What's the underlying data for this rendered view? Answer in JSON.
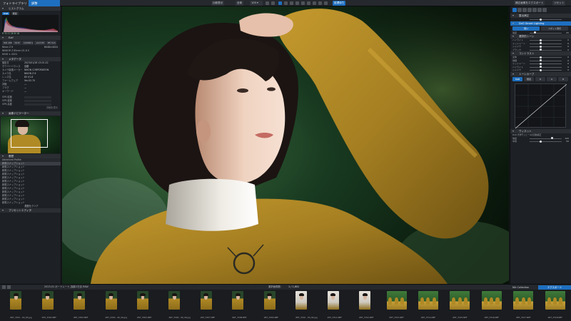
{
  "colors": {
    "accent": "#1e6fbf",
    "panel": "#1d2024",
    "sweater": "#b08a25"
  },
  "topbar": {
    "tab_library": "フォトライブラリ",
    "tab_adjust": "調整",
    "btn_before_after": "比較表示",
    "btn_fit": "全体",
    "zoom": "100",
    "btn_process": "処理待ち",
    "btn_export": "補正画像をエクスポート",
    "btn_reset": "リセット"
  },
  "left": {
    "histogram_title": "ヒストグラム",
    "hist_tabs": [
      "RGB",
      "輝度"
    ],
    "hist_values": "R 31  G 26  B 18",
    "exif_title": "Exif",
    "exif_buttons": [
      "ISO 100",
      "f/2.8",
      "1/2000 s",
      "+0.0 EV",
      "85 mm"
    ],
    "exif_rows": [
      {
        "label": "Nikon Z 6",
        "value": "6048×4024"
      },
      {
        "label": "NIKKOR Z 85mm f/1.8 S",
        "value": ""
      },
      {
        "label": "6048 × 4024",
        "value": ""
      }
    ],
    "meta_title": "メタデータ",
    "meta_rows": [
      {
        "label": "撮影日",
        "value": "2023/01/28 13:01:22"
      },
      {
        "label": "ホワイトバランス",
        "value": "自動"
      },
      {
        "label": "カメラ製造メーカー",
        "value": "NIKON CORPORATION"
      },
      {
        "label": "カメラ名",
        "value": "NIKON Z 6"
      },
      {
        "label": "レンズ名",
        "value": "85 f/1.8"
      },
      {
        "label": "ファームウェア",
        "value": "Ver.02.70"
      },
      {
        "label": "評価",
        "value": "—"
      },
      {
        "label": "フラグ",
        "value": "—"
      },
      {
        "label": "キーワード",
        "value": "—"
      }
    ],
    "gps_rows": [
      "GPS 緯度",
      "GPS 経度",
      "GPS 高度"
    ],
    "gps_footer": "詳細を表示",
    "navigator_title": "画像ナビゲーター",
    "history_title": "履歴",
    "history_top": "Advanced Profile",
    "history_items": [
      "新規スナップショット",
      "新規スナップショット",
      "新規スナップショット",
      "新規スナップショット",
      "新規スナップショット",
      "新規スナップショット",
      "新規スナップショット",
      "新規スナップショット",
      "新規スナップショット",
      "新規スナップショット",
      "新規スナップショット",
      "新規スナップショット"
    ],
    "history_footer": "履歴をクリア",
    "preset_title": "プリセットエディタ"
  },
  "right": {
    "section_light": "露出補正",
    "section_smart": "DxO Smart Lighting",
    "smart_modes": [
      "弱い",
      "スポット測光"
    ],
    "smart_sliders": [
      {
        "label": "強度",
        "value": "25"
      }
    ],
    "tone_title": "選択的トーン",
    "tone_sliders": [
      {
        "label": "ハイライト",
        "value": "0"
      },
      {
        "label": "ミッドトーン",
        "value": "0"
      },
      {
        "label": "シャドウ",
        "value": "0"
      },
      {
        "label": "ブラック",
        "value": "0"
      }
    ],
    "contrast_title": "コントラスト",
    "contrast_sliders": [
      {
        "label": "全体",
        "value": "0"
      },
      {
        "label": "微細",
        "value": "0"
      },
      {
        "label": "ミッドトーン",
        "value": "0"
      },
      {
        "label": "ハイライト",
        "value": "0"
      },
      {
        "label": "シャドウ",
        "value": "0"
      }
    ],
    "curve_title": "トーンカーブ",
    "curve_tabs": [
      "RGB",
      "輝度",
      "R",
      "G",
      "B"
    ],
    "vignette_title": "ヴィネット",
    "vignette_mode": "DxO 光学モジュールの自動補正",
    "vignette_sliders": [
      {
        "label": "強度",
        "value": "100"
      },
      {
        "label": "中間",
        "value": "50"
      }
    ]
  },
  "filmbar": {
    "folder_path": "2023-01 ポートレート_撮影2日目 RAW",
    "count_label": "選択画像数：",
    "count_value": "1 / 1,601",
    "collection": "Nik Collection",
    "export": "エクスポート"
  },
  "filmstrip": [
    {
      "name": "Z6T_3301 - 90_S6.jpg",
      "kind": "sweater"
    },
    {
      "name": "Z6T_3302.NEF",
      "kind": "sweater"
    },
    {
      "name": "Z6T_3303.NEF",
      "kind": "sweater"
    },
    {
      "name": "Z6T_3304 - 90_S6.jpg",
      "kind": "sweater"
    },
    {
      "name": "Z6T_3305.NEF",
      "kind": "sweater"
    },
    {
      "name": "Z6T_3306 - 90_S6.jpg",
      "kind": "sweater"
    },
    {
      "name": "Z6T_3307.NEF",
      "kind": "sweater"
    },
    {
      "name": "Z6T_3308.NEF",
      "kind": "sweater"
    },
    {
      "name": "Z6T_3309.NEF",
      "kind": "sweater"
    },
    {
      "name": "Z6T_3310 - 90_S6.jpg",
      "kind": "dark"
    },
    {
      "name": "Z6T_3311.NEF",
      "kind": "dark"
    },
    {
      "name": "Z6T_3312.NEF",
      "kind": "dark"
    },
    {
      "name": "Z6T_3313.NEF",
      "kind": "green"
    },
    {
      "name": "Z6T_3314.NEF",
      "kind": "green"
    },
    {
      "name": "Z6T_3315.NEF",
      "kind": "green"
    },
    {
      "name": "Z6T_3316.NEF",
      "kind": "green"
    },
    {
      "name": "Z6T_3317.NEF",
      "kind": "green"
    },
    {
      "name": "Z6T_3318.NEF",
      "kind": "green"
    }
  ]
}
